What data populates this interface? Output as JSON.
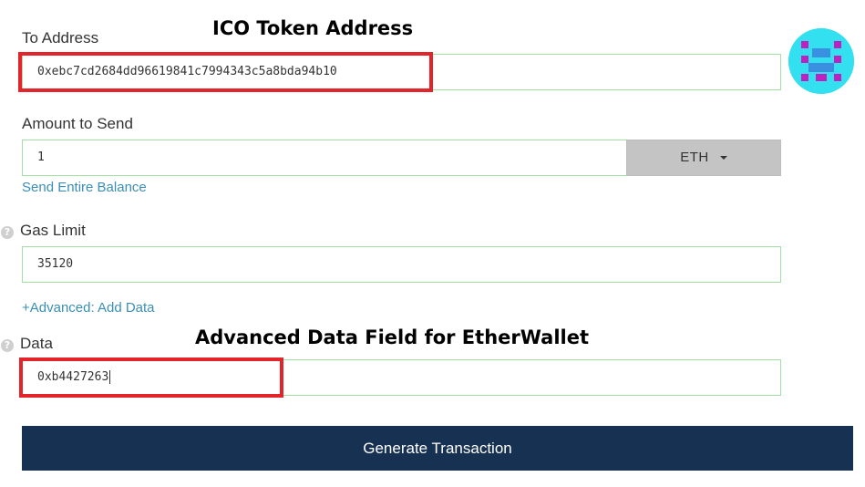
{
  "annotations": {
    "token_address_title": "ICO Token Address",
    "data_field_title": "Advanced Data Field for EtherWallet"
  },
  "to_address": {
    "label": "To Address",
    "value": "0xebc7cd2684dd96619841c7994343c5a8bda94b10"
  },
  "amount": {
    "label": "Amount to Send",
    "value": "1",
    "token": "ETH",
    "send_entire_balance": "Send Entire Balance"
  },
  "gas": {
    "help_icon": "?",
    "label": "Gas Limit",
    "value": "35120",
    "advanced_link": "+Advanced: Add Data"
  },
  "data_field": {
    "help_icon": "?",
    "label": "Data",
    "value": "0xb4427263"
  },
  "generate_button": "Generate Transaction",
  "colors": {
    "field_border": "#a3e0a3",
    "link": "#3b8fb5",
    "button_bg": "#163151",
    "highlight": "#e3242b",
    "identicon_bg": "#33e0f0",
    "identicon_mark": "#c020c0",
    "identicon_eye": "#3b8fe0"
  },
  "icons": {
    "avatar": "identicon",
    "help": "question-circle-icon",
    "dropdown": "caret-down-icon"
  }
}
